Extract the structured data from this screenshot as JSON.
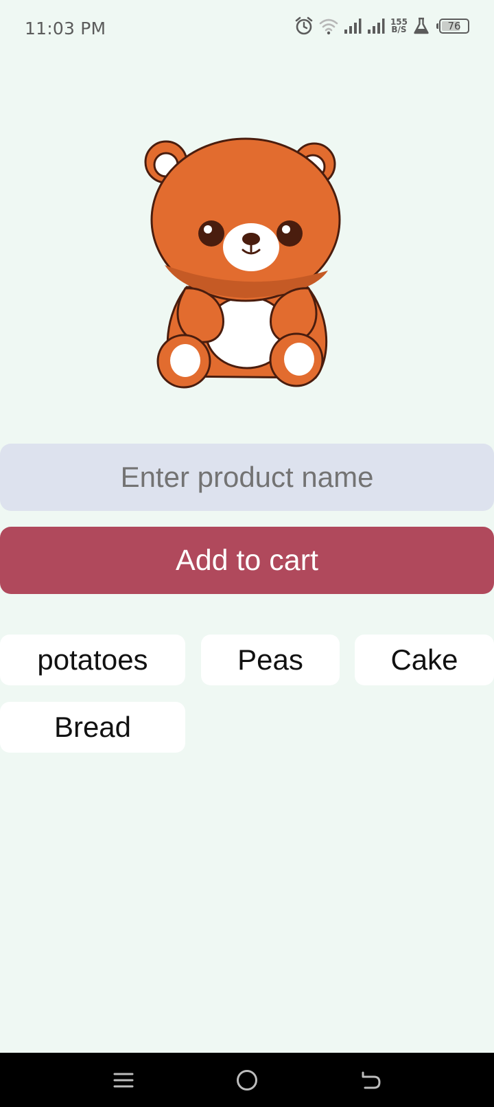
{
  "status_bar": {
    "time": "11:03 PM",
    "net_speed_value": "155",
    "net_speed_unit": "B/S",
    "battery_level": "76",
    "icons": [
      "alarm-icon",
      "wifi-icon",
      "signal-icon",
      "signal-icon",
      "lab-flask-icon",
      "battery-icon"
    ]
  },
  "illustration": {
    "name": "teddy-bear",
    "colors": {
      "body": "#e26c2f",
      "outline": "#4a1d0e",
      "belly": "#ffffff"
    }
  },
  "form": {
    "input_placeholder": "Enter product name",
    "input_value": "",
    "add_button_label": "Add to cart"
  },
  "cart_items": [
    "potatoes",
    "Peas",
    "Cake",
    "Bread"
  ],
  "nav": {
    "icons": [
      "menu-icon",
      "home-icon",
      "back-icon"
    ]
  },
  "colors": {
    "background": "#eff8f3",
    "input_background": "#dde2ee",
    "button_background": "#b0495c",
    "chip_background": "#ffffff"
  }
}
